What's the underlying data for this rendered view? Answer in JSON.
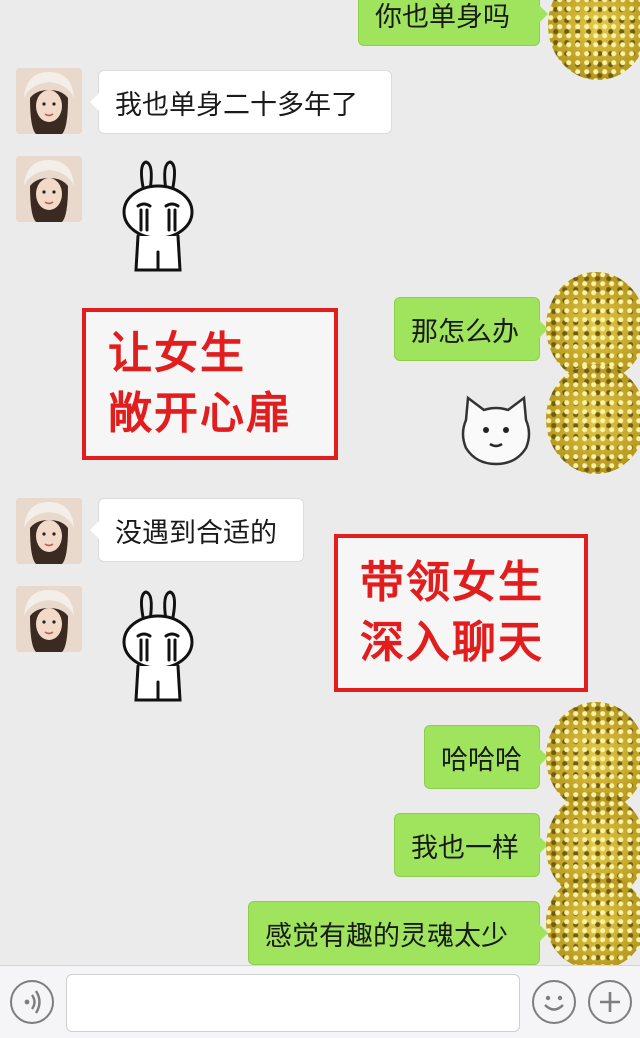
{
  "messages": [
    {
      "side": "out",
      "text": "你也单身吗"
    },
    {
      "side": "in",
      "text": "我也单身二十多年了"
    },
    {
      "side": "in",
      "sticker": "crying-rabbit"
    },
    {
      "side": "out",
      "text": "那怎么办"
    },
    {
      "side": "out",
      "sticker": "cat-face"
    },
    {
      "side": "in",
      "text": "没遇到合适的"
    },
    {
      "side": "in",
      "sticker": "crying-rabbit"
    },
    {
      "side": "out",
      "text": "哈哈哈"
    },
    {
      "side": "out",
      "text": "我也一样"
    },
    {
      "side": "out",
      "text": "感觉有趣的灵魂太少"
    }
  ],
  "overlays": [
    {
      "line1": "让女生",
      "line2": "敞开心扉"
    },
    {
      "line1": "带领女生",
      "line2": "深入聊天"
    }
  ],
  "input_bar": {
    "voice_icon": "voice-icon",
    "emoji_icon": "emoji-icon",
    "plus_icon": "plus-icon",
    "text_value": ""
  },
  "colors": {
    "background": "#ebebeb",
    "outgoing_bubble": "#9fe45c",
    "incoming_bubble": "#ffffff",
    "overlay_red": "#e21d1d"
  }
}
